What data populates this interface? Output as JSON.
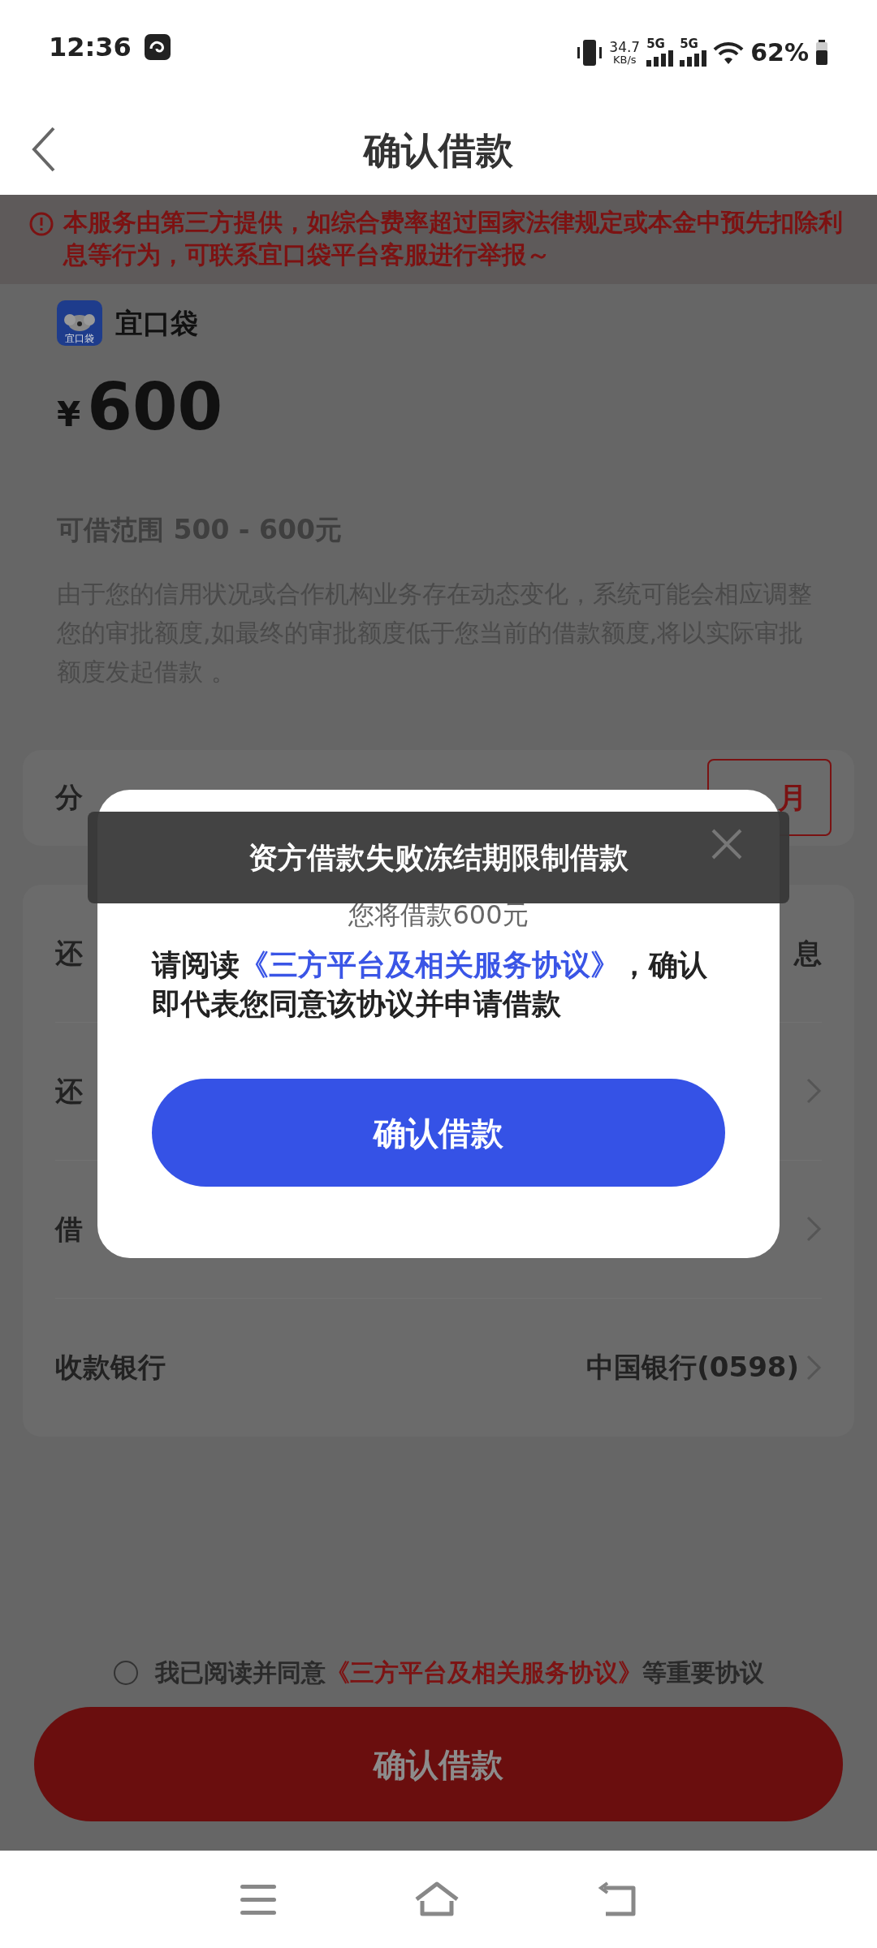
{
  "status_bar": {
    "time": "12:36",
    "net_speed": "34.7",
    "net_unit": "KB/s",
    "signals": [
      {
        "label": "5G"
      },
      {
        "label": "5G"
      }
    ],
    "battery": "62%"
  },
  "header": {
    "title": "确认借款"
  },
  "notice": {
    "text": "本服务由第三方提供，如综合费率超过国家法律规定或本金中预先扣除利息等行为，可联系宜口袋平台客服进行举报～"
  },
  "lender": {
    "logo_text": "宜口袋",
    "name": "宜口袋"
  },
  "amount": {
    "currency": "¥",
    "value": "600"
  },
  "range": "可借范围 500 - 600元",
  "note": "由于您的信用状况或合作机构业务存在动态变化，系统可能会相应调整您的审批额度,如最终的审批额度低于您当前的借款额度,将以实际审批额度发起借款 。",
  "installment": {
    "label": "分",
    "option": "月",
    "selected": true
  },
  "rows": [
    {
      "label": "还",
      "value": "息",
      "chevron": false
    },
    {
      "label": "还",
      "chevron": true
    },
    {
      "label": "借",
      "chevron": true
    },
    {
      "label": "收款银行",
      "value": "中国银行(0598)",
      "chevron": true
    }
  ],
  "agreement": {
    "checked": false,
    "prefix": "我已阅读并同意",
    "link": "《三方平台及相关服务协议》",
    "suffix": "等重要协议"
  },
  "submit": "确认借款",
  "modal": {
    "subtitle": "您将借款600元",
    "prefix": "请阅读",
    "link": "《三方平台及相关服务协议》",
    "suffix": "，确认即代表您同意该协议并申请借款",
    "button": "确认借款"
  },
  "toast": "资方借款失败冻结期限制借款"
}
